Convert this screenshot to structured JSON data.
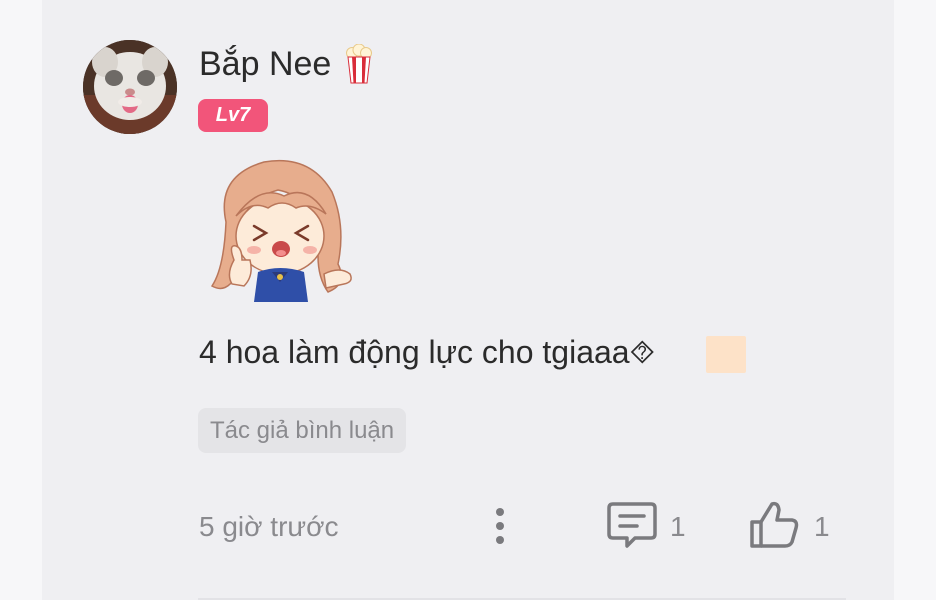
{
  "comment": {
    "username": "Bắp Nee",
    "level": "Lv7",
    "text": "4 hoa làm động lực cho tgiaaa⯑",
    "author_tag": "Tác giả bình luận",
    "time": "5 giờ trước",
    "reply_count": "1",
    "like_count": "1"
  },
  "icons": {
    "username_emoji": "popcorn-icon",
    "more": "more-vertical-icon",
    "reply": "comment-icon",
    "like": "thumbs-up-icon"
  },
  "colors": {
    "card_background": "#efeff2",
    "level_badge": "#f2557a",
    "secondary_text": "#8a8a8e",
    "primary_text": "#2b2b2b"
  }
}
